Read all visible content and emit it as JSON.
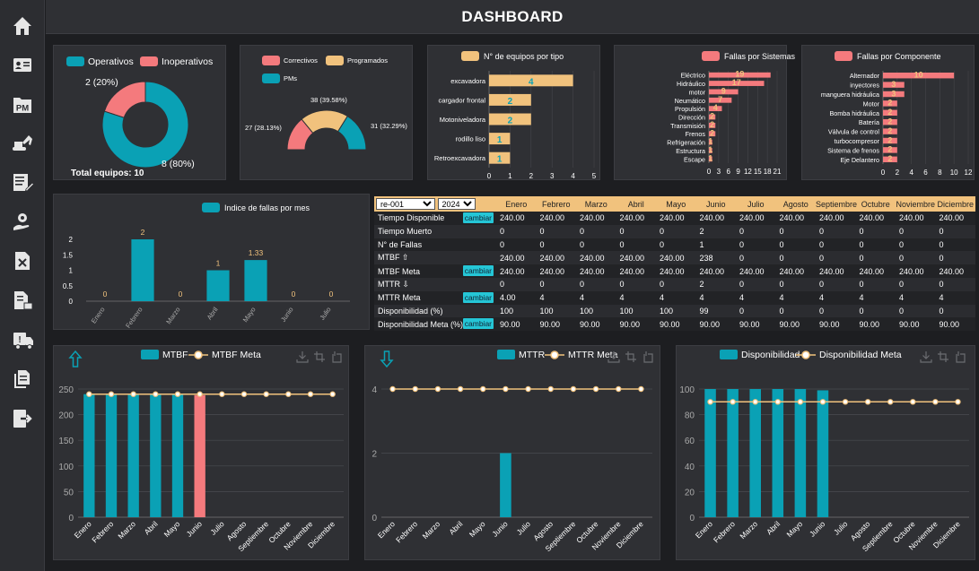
{
  "header": {
    "title": "DASHBOARD"
  },
  "sidebar": {
    "items": [
      {
        "icon": "home-icon"
      },
      {
        "icon": "id-card-icon"
      },
      {
        "icon": "pm-folder-icon",
        "label": "PM"
      },
      {
        "icon": "excavator-icon"
      },
      {
        "icon": "list-edit-icon"
      },
      {
        "icon": "gear-hand-icon"
      },
      {
        "icon": "document-tools-icon"
      },
      {
        "icon": "document-lock-icon"
      },
      {
        "icon": "delivery-truck-icon"
      },
      {
        "icon": "documents-icon"
      },
      {
        "icon": "logout-icon"
      }
    ]
  },
  "colors": {
    "teal": "#0aa1b5",
    "red": "#f47a7d",
    "yellow": "#f1c27d",
    "panel": "#2f3034"
  },
  "status_donut": {
    "chart_data": {
      "type": "pie",
      "legend": [
        "Operativos",
        "Inoperativos"
      ],
      "values": [
        8,
        2
      ],
      "labels": [
        "8 (80%)",
        "2 (20%)"
      ],
      "total_label": "Total equipos: 10"
    }
  },
  "maintenance_pie": {
    "chart_data": {
      "type": "pie",
      "legend": [
        "Correctivos",
        "Programados",
        "PMs"
      ],
      "values": [
        27,
        38,
        31
      ],
      "labels": [
        "27 (28.13%)",
        "38 (39.58%)",
        "31 (32.29%)"
      ]
    }
  },
  "equipos_tipo": {
    "chart_data": {
      "type": "bar",
      "orientation": "horizontal",
      "legend": "N° de equipos por tipo",
      "categories": [
        "excavadora",
        "cargador frontal",
        "Motoniveladora",
        "rodillo liso",
        "Retroexcavadora"
      ],
      "values": [
        4,
        2,
        2,
        1,
        1
      ],
      "xlim": [
        0,
        5
      ],
      "xticks": [
        "0",
        "1",
        "2",
        "3",
        "4",
        "5"
      ]
    }
  },
  "fallas_sistemas": {
    "chart_data": {
      "type": "bar",
      "orientation": "horizontal",
      "legend": "Fallas por Sistemas",
      "categories": [
        "Eléctrico",
        "Hidráulico",
        "motor",
        "Neumático",
        "Propulsión",
        "Dirección",
        "Transmisión",
        "Frenos",
        "Refrigeración",
        "Estructura",
        "Escape"
      ],
      "values": [
        19,
        17,
        9,
        7,
        4,
        2,
        2,
        2,
        1,
        1,
        1
      ],
      "xlim": [
        0,
        21
      ],
      "xticks": [
        "0",
        "3",
        "6",
        "9",
        "12",
        "15",
        "18",
        "21"
      ]
    }
  },
  "fallas_componente": {
    "chart_data": {
      "type": "bar",
      "orientation": "horizontal",
      "legend": "Fallas por Componente",
      "categories": [
        "Alternador",
        "inyectores",
        "manguera hidráulica",
        "Motor",
        "Bomba hidráulica",
        "Batería",
        "Válvula de control",
        "turbocompresor",
        "Sistema de frenos",
        "Eje Delantero"
      ],
      "values": [
        10,
        3,
        3,
        2,
        2,
        2,
        2,
        2,
        2,
        2
      ],
      "xlim": [
        0,
        12
      ],
      "xticks": [
        "0",
        "2",
        "4",
        "6",
        "8",
        "10",
        "12"
      ]
    }
  },
  "fallas_mes": {
    "chart_data": {
      "type": "bar",
      "legend": "Indice de fallas por mes",
      "categories": [
        "Enero",
        "Febrero",
        "Marzo",
        "Abril",
        "Mayo",
        "Junio",
        "Julio"
      ],
      "values": [
        0,
        2,
        0,
        1,
        1.33,
        0,
        0
      ],
      "value_labels": [
        "0",
        "2",
        "0",
        "1",
        "1.33",
        "0",
        "0"
      ],
      "ylim": [
        0,
        2
      ],
      "yticks": [
        "0",
        "0.5",
        "1",
        "1.5",
        "2"
      ]
    }
  },
  "table": {
    "equipment_select": "re-001",
    "year_select": "2024",
    "months": [
      "Enero",
      "Febrero",
      "Marzo",
      "Abril",
      "Mayo",
      "Junio",
      "Julio",
      "Agosto",
      "Septiembre",
      "Octubre",
      "Noviembre",
      "Diciembre"
    ],
    "change_label": "cambiar",
    "rows": [
      {
        "label": "Tiempo Disponible",
        "button": true,
        "values": [
          "240.00",
          "240.00",
          "240.00",
          "240.00",
          "240.00",
          "240.00",
          "240.00",
          "240.00",
          "240.00",
          "240.00",
          "240.00",
          "240.00"
        ]
      },
      {
        "label": "Tiempo Muerto",
        "button": false,
        "values": [
          "0",
          "0",
          "0",
          "0",
          "0",
          "2",
          "0",
          "0",
          "0",
          "0",
          "0",
          "0"
        ]
      },
      {
        "label": "N° de Fallas",
        "button": false,
        "values": [
          "0",
          "0",
          "0",
          "0",
          "0",
          "1",
          "0",
          "0",
          "0",
          "0",
          "0",
          "0"
        ]
      },
      {
        "label": "MTBF ⇧",
        "button": false,
        "values": [
          "240.00",
          "240.00",
          "240.00",
          "240.00",
          "240.00",
          "238",
          "0",
          "0",
          "0",
          "0",
          "0",
          "0"
        ]
      },
      {
        "label": "MTBF Meta",
        "button": true,
        "values": [
          "240.00",
          "240.00",
          "240.00",
          "240.00",
          "240.00",
          "240.00",
          "240.00",
          "240.00",
          "240.00",
          "240.00",
          "240.00",
          "240.00"
        ]
      },
      {
        "label": "MTTR ⇩",
        "button": false,
        "values": [
          "0",
          "0",
          "0",
          "0",
          "0",
          "2",
          "0",
          "0",
          "0",
          "0",
          "0",
          "0"
        ]
      },
      {
        "label": "MTTR Meta",
        "button": true,
        "values": [
          "4.00",
          "4",
          "4",
          "4",
          "4",
          "4",
          "4",
          "4",
          "4",
          "4",
          "4",
          "4"
        ]
      },
      {
        "label": "Disponibilidad (%)",
        "button": false,
        "values": [
          "100",
          "100",
          "100",
          "100",
          "100",
          "99",
          "0",
          "0",
          "0",
          "0",
          "0",
          "0"
        ]
      },
      {
        "label": "Disponibilidad Meta (%)",
        "button": true,
        "values": [
          "90.00",
          "90.00",
          "90.00",
          "90.00",
          "90.00",
          "90.00",
          "90.00",
          "90.00",
          "90.00",
          "90.00",
          "90.00",
          "90.00"
        ]
      }
    ]
  },
  "mtbf_chart": {
    "chart_data": {
      "type": "bar",
      "legend": [
        "MTBF",
        "MTBF Meta"
      ],
      "categories": [
        "Enero",
        "Febrero",
        "Marzo",
        "Abril",
        "Mayo",
        "Junio",
        "Julio",
        "Agosto",
        "Septiembre",
        "Octubre",
        "Noviembre",
        "Diciembre"
      ],
      "series": [
        {
          "name": "MTBF",
          "type": "bar",
          "values": [
            240,
            240,
            240,
            240,
            240,
            238,
            0,
            0,
            0,
            0,
            0,
            0
          ]
        },
        {
          "name": "MTBF Meta",
          "type": "line",
          "values": [
            240,
            240,
            240,
            240,
            240,
            240,
            240,
            240,
            240,
            240,
            240,
            240
          ]
        }
      ],
      "highlight_color_index": 5,
      "ylim": [
        0,
        250
      ],
      "yticks": [
        "0",
        "50",
        "100",
        "150",
        "200",
        "250"
      ],
      "direction_icon": "arrow-up-icon"
    }
  },
  "mttr_chart": {
    "chart_data": {
      "type": "bar",
      "legend": [
        "MTTR",
        "MTTR Meta"
      ],
      "categories": [
        "Enero",
        "Febrero",
        "Marzo",
        "Abril",
        "Mayo",
        "Junio",
        "Julio",
        "Agosto",
        "Septiembre",
        "Octubre",
        "Noviembre",
        "Diciembre"
      ],
      "series": [
        {
          "name": "MTTR",
          "type": "bar",
          "values": [
            0,
            0,
            0,
            0,
            0,
            2,
            0,
            0,
            0,
            0,
            0,
            0
          ]
        },
        {
          "name": "MTTR Meta",
          "type": "line",
          "values": [
            4,
            4,
            4,
            4,
            4,
            4,
            4,
            4,
            4,
            4,
            4,
            4
          ]
        }
      ],
      "ylim": [
        0,
        4
      ],
      "yticks": [
        "0",
        "2",
        "4"
      ],
      "direction_icon": "arrow-down-icon"
    }
  },
  "disp_chart": {
    "chart_data": {
      "type": "bar",
      "legend": [
        "Disponibilidad",
        "Disponibilidad Meta"
      ],
      "categories": [
        "Enero",
        "Febrero",
        "Marzo",
        "Abril",
        "Mayo",
        "Junio",
        "Julio",
        "Agosto",
        "Septiembre",
        "Octubre",
        "Noviembre",
        "Diciembre"
      ],
      "series": [
        {
          "name": "Disponibilidad",
          "type": "bar",
          "values": [
            100,
            100,
            100,
            100,
            100,
            99,
            0,
            0,
            0,
            0,
            0,
            0
          ]
        },
        {
          "name": "Disponibilidad Meta",
          "type": "line",
          "values": [
            90,
            90,
            90,
            90,
            90,
            90,
            90,
            90,
            90,
            90,
            90,
            90
          ]
        }
      ],
      "ylim": [
        0,
        100
      ],
      "yticks": [
        "0",
        "20",
        "40",
        "60",
        "80",
        "100"
      ]
    }
  }
}
